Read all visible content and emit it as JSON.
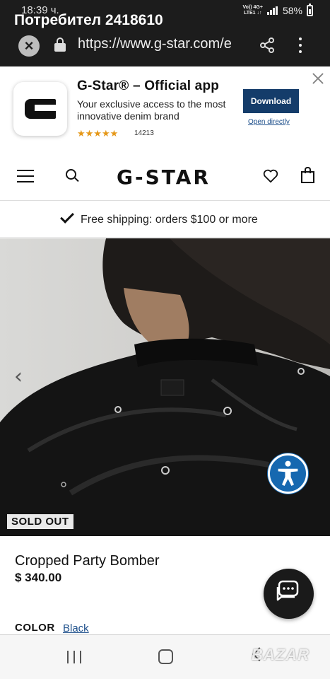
{
  "status_bar": {
    "time": "18:39 ч.",
    "user": "Потребител 2418610",
    "network_top": "Vo)) 4G+",
    "network_bottom": "LTE1 ↓↑",
    "battery": "58%"
  },
  "browser": {
    "url": "https://www.g-star.com/e",
    "close_icon": "close-icon",
    "lock_icon": "lock-icon",
    "share_icon": "share-icon",
    "menu_icon": "more-vert-icon"
  },
  "app_banner": {
    "title": "G-Star® – Official app",
    "description": "Your exclusive access to the most innovative denim brand",
    "stars": "★★★★★",
    "rating_value": 4.5,
    "rating_count": "14213",
    "download_label": "Download",
    "open_label": "Open directly",
    "accent_color": "#143c6a"
  },
  "header": {
    "logo": "G-STAR"
  },
  "shipping": {
    "text": "Free shipping: orders $100 or more"
  },
  "hero": {
    "prev_glyph": "‹",
    "badge": "SOLD OUT"
  },
  "product": {
    "name": "Cropped Party Bomber",
    "price": "$ 340.00",
    "color_label": "COLOR",
    "color_value": "Black"
  },
  "watermark": "BAZAR"
}
